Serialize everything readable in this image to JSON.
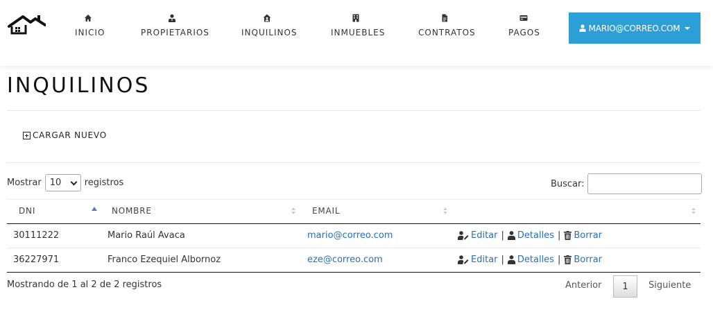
{
  "nav": {
    "items": [
      {
        "label": "INICIO",
        "icon": "home-icon"
      },
      {
        "label": "PROPIETARIOS",
        "icon": "user-tie-icon"
      },
      {
        "label": "INQUILINOS",
        "icon": "house-user-icon"
      },
      {
        "label": "INMUEBLES",
        "icon": "building-icon"
      },
      {
        "label": "CONTRATOS",
        "icon": "file-icon"
      },
      {
        "label": "PAGOS",
        "icon": "credit-card-icon"
      }
    ],
    "user_label": "MARIO@CORREO.COM"
  },
  "page": {
    "title": "INQUILINOS",
    "new_button": "CARGAR NUEVO"
  },
  "table_controls": {
    "show_prefix": "Mostrar",
    "page_length": "10",
    "show_suffix": "registros",
    "search_label": "Buscar:",
    "search_value": "",
    "search_placeholder": ""
  },
  "table": {
    "columns": [
      "DNI",
      "NOMBRE",
      "EMAIL",
      ""
    ],
    "rows": [
      {
        "dni": "30111222",
        "nombre": "Mario Raúl Avaca",
        "email": "mario@correo.com",
        "edit": "Editar",
        "details": "Detalles",
        "delete": "Borrar"
      },
      {
        "dni": "36227971",
        "nombre": "Franco Ezequiel Albornoz",
        "email": "eze@correo.com",
        "edit": "Editar",
        "details": "Detalles",
        "delete": "Borrar"
      }
    ]
  },
  "footer": {
    "info": "Mostrando de 1 al 2 de 2 registros",
    "prev": "Anterior",
    "page": "1",
    "next": "Siguiente"
  },
  "colors": {
    "accent": "#2b9fd6",
    "link": "#2a6fb5"
  }
}
